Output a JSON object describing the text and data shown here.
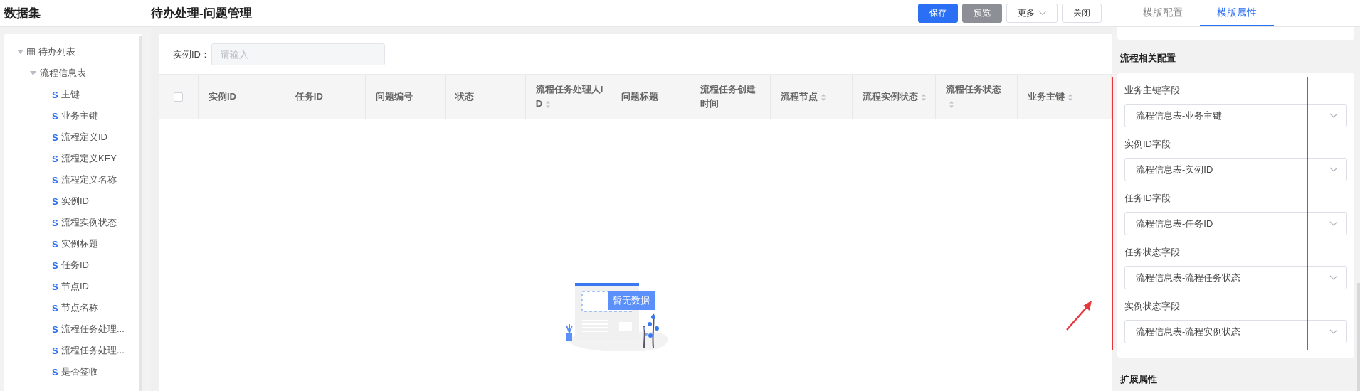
{
  "dataset_panel": {
    "title": "数据集",
    "tree": [
      {
        "label": "待办列表",
        "expanded": true,
        "children": [
          {
            "label": "流程信息表",
            "expanded": true,
            "children": [
              {
                "label": "主键",
                "kind": "string",
                "icon": "S"
              },
              {
                "label": "业务主键",
                "kind": "string",
                "icon": "S"
              },
              {
                "label": "流程定义ID",
                "kind": "string",
                "icon": "S"
              },
              {
                "label": "流程定义KEY",
                "kind": "string",
                "icon": "S"
              },
              {
                "label": "流程定义名称",
                "kind": "string",
                "icon": "S"
              },
              {
                "label": "实例ID",
                "kind": "string",
                "icon": "S"
              },
              {
                "label": "流程实例状态",
                "kind": "string",
                "icon": "S"
              },
              {
                "label": "实例标题",
                "kind": "string",
                "icon": "S"
              },
              {
                "label": "任务ID",
                "kind": "string",
                "icon": "S"
              },
              {
                "label": "节点ID",
                "kind": "string",
                "icon": "S"
              },
              {
                "label": "节点名称",
                "kind": "string",
                "icon": "S"
              },
              {
                "label": "流程任务处理...",
                "kind": "string",
                "icon": "S"
              },
              {
                "label": "流程任务处理...",
                "kind": "string",
                "icon": "S"
              },
              {
                "label": "是否签收",
                "kind": "string",
                "icon": "S"
              }
            ]
          }
        ]
      }
    ]
  },
  "page": {
    "title": "待办处理-问题管理"
  },
  "toolbar": [
    {
      "label": "保存",
      "kind": "primary"
    },
    {
      "label": "预览",
      "kind": "secondary"
    },
    {
      "label": "更多",
      "kind": "dropdown"
    },
    {
      "label": "关闭",
      "kind": "default"
    }
  ],
  "tabs": [
    {
      "label": "模版配置",
      "selected": false
    },
    {
      "label": "模版属性",
      "selected": true
    }
  ],
  "filter": {
    "label": "实例ID：",
    "placeholder": "请输入"
  },
  "table": {
    "select_all_checked": false,
    "columns": [
      {
        "label": "实例ID",
        "sortable": false
      },
      {
        "label": "任务ID",
        "sortable": false
      },
      {
        "label": "问题编号",
        "sortable": false
      },
      {
        "label": "状态",
        "sortable": false
      },
      {
        "label": "流程任务处理人ID",
        "sortable": true
      },
      {
        "label": "问题标题",
        "sortable": false
      },
      {
        "label": "流程任务创建时间",
        "sortable": false
      },
      {
        "label": "流程节点",
        "sortable": true
      },
      {
        "label": "流程实例状态",
        "sortable": true
      },
      {
        "label": "流程任务状态",
        "sortable": true
      },
      {
        "label": "业务主键",
        "sortable": true
      }
    ],
    "empty_text": "暂无数据"
  },
  "properties": {
    "section_title": "流程相关配置",
    "fields": [
      {
        "label": "业务主键字段",
        "value": "流程信息表-业务主键"
      },
      {
        "label": "实例ID字段",
        "value": "流程信息表-实例ID"
      },
      {
        "label": "任务ID字段",
        "value": "流程信息表-任务ID"
      },
      {
        "label": "任务状态字段",
        "value": "流程信息表-流程任务状态"
      },
      {
        "label": "实例状态字段",
        "value": "流程信息表-流程实例状态"
      }
    ],
    "next_section_title": "扩展属性"
  }
}
